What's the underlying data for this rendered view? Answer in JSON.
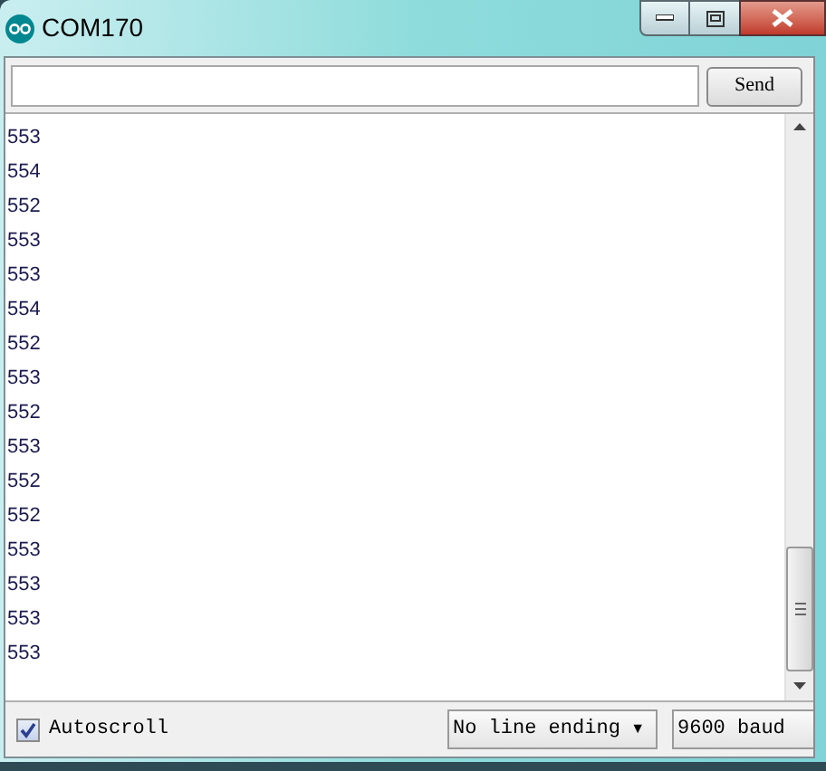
{
  "window": {
    "title": "COM170"
  },
  "send_button": {
    "label": "Send"
  },
  "output_lines": [
    "553",
    "554",
    "552",
    "553",
    "553",
    "554",
    "552",
    "553",
    "552",
    "553",
    "552",
    "552",
    "553",
    "553",
    "553",
    "553"
  ],
  "autoscroll": {
    "label": "Autoscroll",
    "checked": true
  },
  "line_ending": {
    "value": "No line ending",
    "arrow": "▼"
  },
  "baud": {
    "value": "9600 baud"
  }
}
